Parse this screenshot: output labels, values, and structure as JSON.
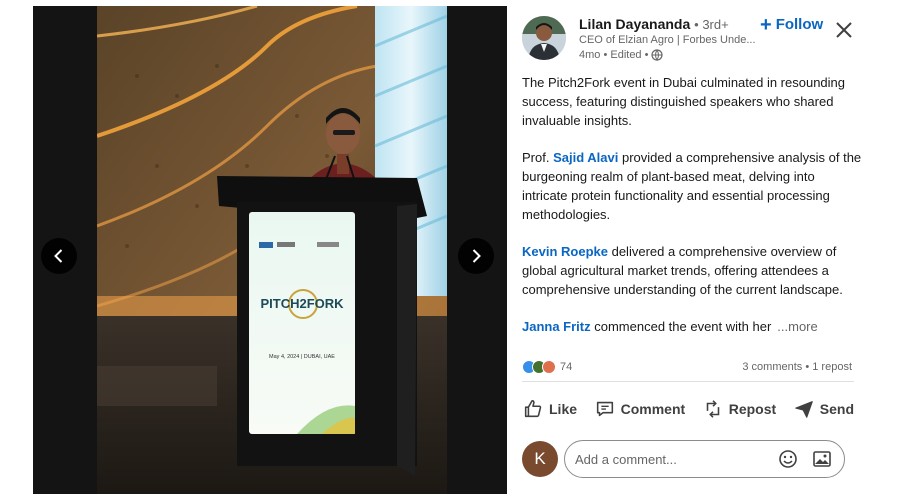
{
  "viewer": {
    "prev_icon": "chevron-left-icon",
    "next_icon": "chevron-right-icon",
    "podium": {
      "event_name": "PITCH2FORK",
      "date_line": "May 4, 2024  |  DUBAI, UAE"
    }
  },
  "post": {
    "author": {
      "name": "Lilan Dayananda",
      "degree": "• 3rd+",
      "headline": "CEO of Elzian Agro | Forbes Unde...",
      "meta": "4mo • Edited •",
      "visibility_icon": "globe-icon"
    },
    "follow_label": "Follow",
    "close_icon": "close-icon",
    "paragraphs": {
      "p1": "The Pitch2Fork event in Dubai culminated in resounding success, featuring distinguished speakers who shared invaluable insights.",
      "p2_prefix": "Prof. ",
      "p2_mention": "Sajid Alavi",
      "p2_suffix": " provided a comprehensive analysis of the burgeoning realm of plant-based meat, delving into intricate protein functionality and essential processing methodologies.",
      "p3_mention": "Kevin Roepke",
      "p3_suffix": " delivered a comprehensive overview of global agricultural market trends, offering attendees a comprehensive understanding of the current landscape.",
      "p4_mention": "Janna Fritz",
      "p4_suffix": " commenced the event with her",
      "see_more": "...more"
    },
    "reactions": {
      "count": "74",
      "stats": "3 comments • 1 repost",
      "colors": [
        "#378fe9",
        "#44712e",
        "#df704d"
      ]
    },
    "actions": {
      "like": "Like",
      "comment": "Comment",
      "repost": "Repost",
      "send": "Send"
    },
    "comment_box": {
      "avatar_initial": "K",
      "placeholder": "Add a comment...",
      "emoji_icon": "emoji-icon",
      "image_icon": "image-icon"
    }
  }
}
